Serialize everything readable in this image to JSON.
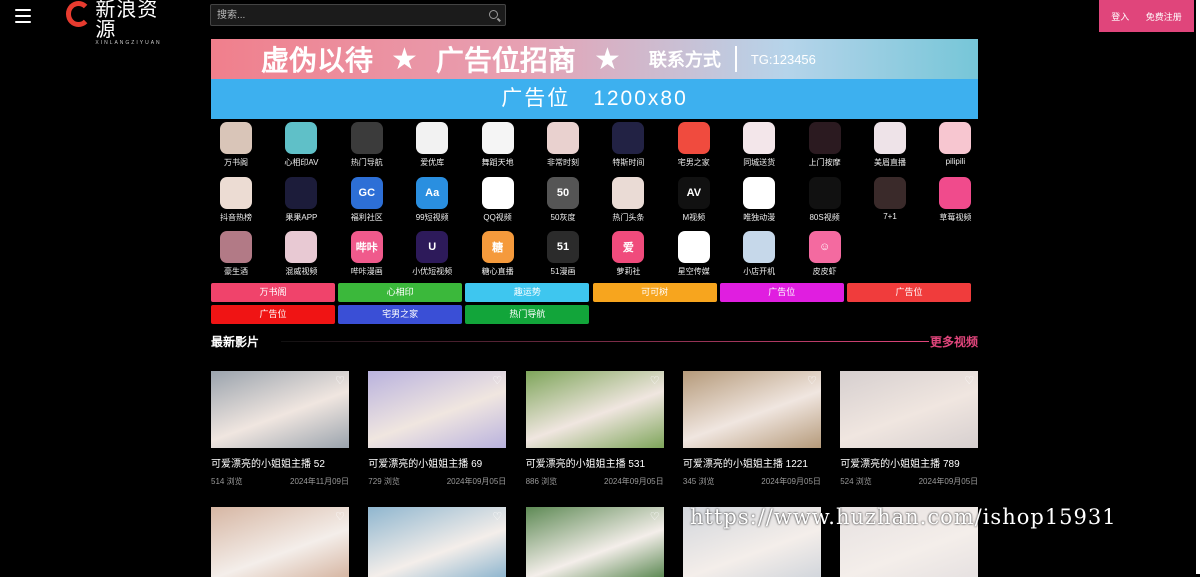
{
  "header": {
    "logo_cn": "新浪资源",
    "logo_en": "XINLANGZIYUAN",
    "search_placeholder": "搜索...",
    "login": "登入",
    "register": "免费注册"
  },
  "banner": {
    "line1_a": "虚伪以待",
    "line1_b": "广告位招商",
    "line1_c": "联系方式",
    "line1_tg": "TG:123456",
    "line2": "广告位　1200x80"
  },
  "apps": [
    {
      "label": "万书阁",
      "color": "#d9c5b8"
    },
    {
      "label": "心相印AV",
      "color": "#5fc0c8"
    },
    {
      "label": "热门导航",
      "color": "#3b3b3b"
    },
    {
      "label": "爱优库",
      "color": "#f2f2f2"
    },
    {
      "label": "舞蹈天地",
      "color": "#f5f5f5"
    },
    {
      "label": "非常时刻",
      "color": "#e9d1cf"
    },
    {
      "label": "特斯时间",
      "color": "#222244"
    },
    {
      "label": "宅男之家",
      "color": "#f04b3e"
    },
    {
      "label": "同城送货",
      "color": "#f3e6ea"
    },
    {
      "label": "上门按摩",
      "color": "#2b1a20"
    },
    {
      "label": "美眉直播",
      "color": "#eee3e8"
    },
    {
      "label": "pilipili",
      "color": "#f7c6d0"
    },
    {
      "label": "抖音热榜",
      "color": "#ecdcd3"
    },
    {
      "label": "果果APP",
      "color": "#1c1c3a"
    },
    {
      "label": "福利社区",
      "color": "#2d6fd6"
    },
    {
      "label": "99短视频",
      "color": "#2a8fe0"
    },
    {
      "label": "QQ视频",
      "color": "#ffffff"
    },
    {
      "label": "50灰度",
      "color": "#555555"
    },
    {
      "label": "热门头条",
      "color": "#eadbd5"
    },
    {
      "label": "M视频",
      "color": "#111111"
    },
    {
      "label": "唯独动漫",
      "color": "#ffffff"
    },
    {
      "label": "80S视频",
      "color": "#111111"
    },
    {
      "label": "7+1",
      "color": "#3a2a2a"
    },
    {
      "label": "草莓视频",
      "color": "#f04b8c"
    },
    {
      "label": "豪生酒",
      "color": "#b27a86"
    },
    {
      "label": "混威视频",
      "color": "#e8c9d3"
    },
    {
      "label": "哔咔漫画",
      "color": "#f05a8c"
    },
    {
      "label": "小优短视频",
      "color": "#2d1a5a"
    },
    {
      "label": "糖心直播",
      "color": "#f59a3c"
    },
    {
      "label": "51漫画",
      "color": "#2b2b2b"
    },
    {
      "label": "萝莉社",
      "color": "#f04b7c"
    },
    {
      "label": "星空传媒",
      "color": "#ffffff"
    },
    {
      "label": "小店开机",
      "color": "#c6d8ea"
    },
    {
      "label": "皮皮虾",
      "color": "#f46aa0"
    }
  ],
  "icon_glyphs": [
    "",
    "",
    "",
    "",
    "",
    "",
    "",
    "",
    "",
    "",
    "",
    "",
    "",
    "",
    "GC",
    "Aa",
    "",
    "50",
    "",
    "AV",
    "",
    "",
    "",
    "",
    "",
    "",
    "哔咔",
    "U",
    "糖",
    "51",
    "爱",
    "",
    "",
    "☺"
  ],
  "tags": [
    {
      "label": "万书阁",
      "color": "#f0436b"
    },
    {
      "label": "心相印",
      "color": "#3bb83b"
    },
    {
      "label": "趣运势",
      "color": "#3ec6ef"
    },
    {
      "label": "可可树",
      "color": "#f7a51e"
    },
    {
      "label": "广告位",
      "color": "#e01ee0"
    },
    {
      "label": "广告位",
      "color": "#f03c3c"
    },
    {
      "label": "广告位",
      "color": "#f01414"
    },
    {
      "label": "宅男之家",
      "color": "#3a4fd6"
    },
    {
      "label": "热门导航",
      "color": "#12a53a"
    }
  ],
  "section": {
    "title": "最新影片",
    "more": "更多视频"
  },
  "videos": [
    {
      "title": "可爱漂亮的小姐姐主播 52",
      "views": "514 浏览",
      "date": "2024年11月09日",
      "thumb": "#9aa3ad"
    },
    {
      "title": "可爱漂亮的小姐姐主播 69",
      "views": "729 浏览",
      "date": "2024年09月05日",
      "thumb": "#b9b2de"
    },
    {
      "title": "可爱漂亮的小姐姐主播 531",
      "views": "886 浏览",
      "date": "2024年09月05日",
      "thumb": "#7ea55a"
    },
    {
      "title": "可爱漂亮的小姐姐主播 1221",
      "views": "345 浏览",
      "date": "2024年09月05日",
      "thumb": "#b59a7a"
    },
    {
      "title": "可爱漂亮的小姐姐主播 789",
      "views": "524 浏览",
      "date": "2024年09月05日",
      "thumb": "#d6cfcf"
    }
  ],
  "videos_row2": [
    {
      "thumb": "#d6b6a3"
    },
    {
      "thumb": "#8fb6cf"
    },
    {
      "thumb": "#5e8a55"
    },
    {
      "thumb": "#d2d6dc"
    },
    {
      "thumb": "#e6e1e1"
    }
  ],
  "watermark": "https://www.huzhan.com/ishop15931"
}
